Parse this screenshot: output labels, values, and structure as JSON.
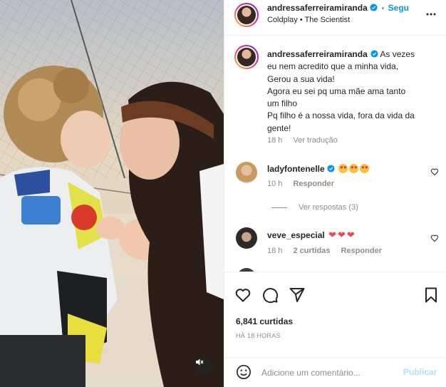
{
  "post": {
    "author": "andressaferreiramiranda",
    "follow_label": "Segu",
    "music": "Coldplay • The Scientist"
  },
  "caption": {
    "author": "andressaferreiramiranda",
    "text_lines": [
      "As vezes",
      "eu nem acredito que a minha vida,",
      "Gerou a sua vida!",
      "Agora eu sei pq uma mãe ama tanto",
      "um filho",
      "Pq filho é a nossa vida, fora da vida da",
      "gente!"
    ],
    "time": "18 h",
    "translate": "Ver tradução"
  },
  "comments": [
    {
      "user": "ladyfontenelle",
      "time": "10 h",
      "reply": "Responder",
      "view_replies": "Ver respostas (3)"
    },
    {
      "user": "veve_especial",
      "time": "18 h",
      "likes": "2 curtidas",
      "reply": "Responder"
    }
  ],
  "stats": {
    "likes": "6,841 curtidas",
    "time": "HÁ 18 HORAS"
  },
  "composer": {
    "placeholder": "Adicione um comentário...",
    "publish": "Publicar"
  },
  "icons": {
    "verified": "verified-badge-icon",
    "more": "more-options-icon",
    "heart": "heart-icon",
    "comment": "comment-icon",
    "share": "share-icon",
    "save": "bookmark-icon",
    "emoji": "emoji-icon",
    "mute": "mute-icon"
  },
  "colors": {
    "accent": "#0095f6",
    "publish_disabled": "#b2dffc",
    "heart_red": "#ed4956",
    "secondary_text": "#8e8e8e"
  }
}
